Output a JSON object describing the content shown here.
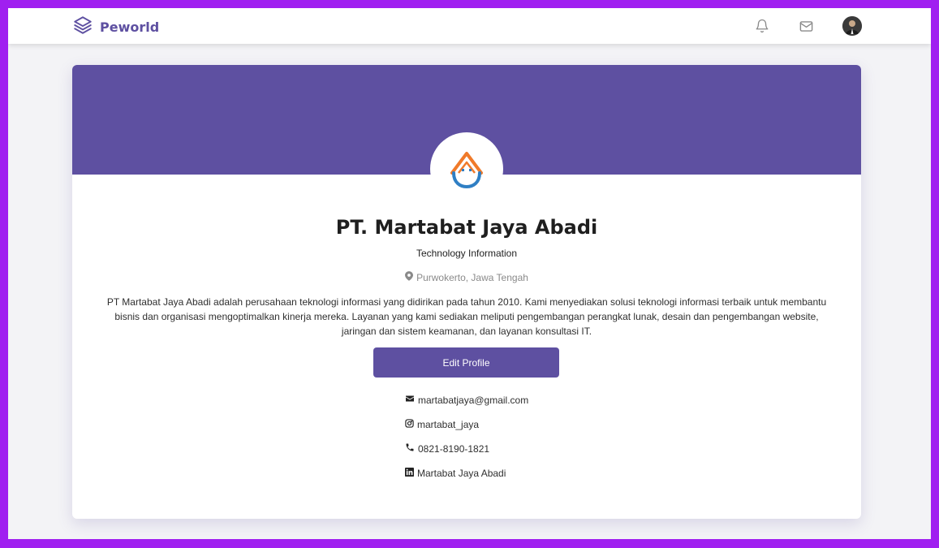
{
  "navbar": {
    "brand": "Peworld",
    "icons": [
      "layers-icon",
      "bell-icon",
      "mail-icon"
    ]
  },
  "profile": {
    "company_name": "PT. Martabat Jaya Abadi",
    "field": "Technology Information",
    "location": "Purwokerto, Jawa Tengah",
    "description": "PT Martabat Jaya Abadi adalah perusahaan teknologi informasi yang didirikan pada tahun 2010. Kami menyediakan solusi teknologi informasi terbaik untuk membantu bisnis dan organisasi mengoptimalkan kinerja mereka. Layanan yang kami sediakan meliputi pengembangan perangkat lunak, desain dan pengembangan website, jaringan dan sistem keamanan, dan layanan konsultasi IT.",
    "edit_button": "Edit Profile"
  },
  "contacts": {
    "email": "martabatjaya@gmail.com",
    "instagram": "martabat_jaya",
    "phone": "0821-8190-1821",
    "linkedin": "Martabat Jaya Abadi"
  },
  "colors": {
    "brand": "#5e50a1",
    "border_frame": "#a01ff0",
    "logo_orange": "#f07a2a",
    "logo_blue": "#2f7fc4"
  }
}
